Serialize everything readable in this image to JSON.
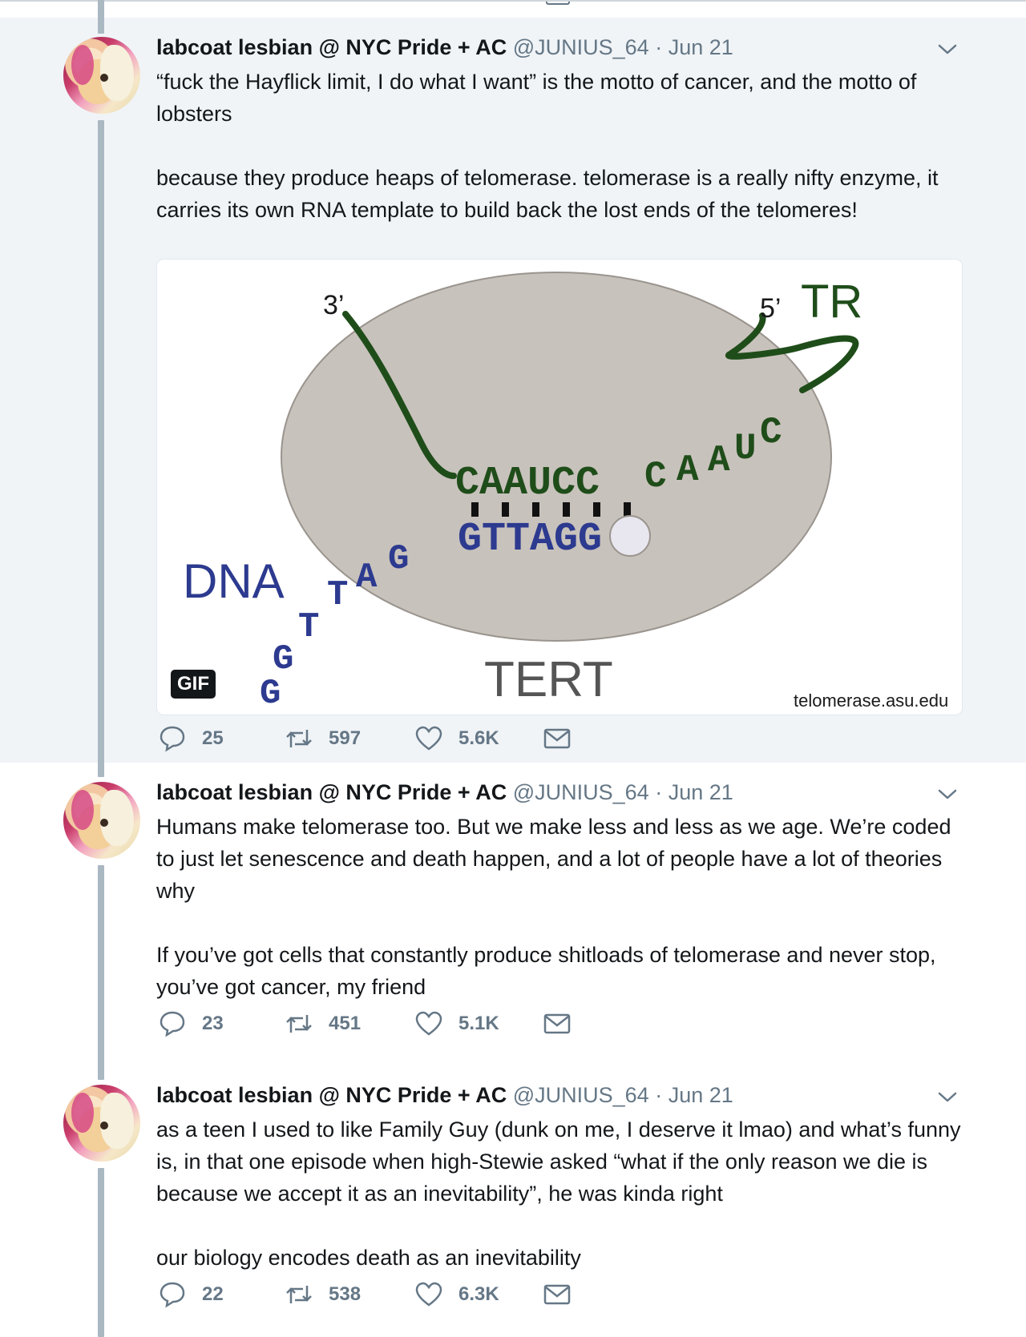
{
  "tweets": [
    {
      "name": "labcoat lesbian @ NYC Pride + AC",
      "handle": "@JUNIUS_64",
      "dot": "·",
      "date": "Jun 21",
      "paragraphs": [
        "“fuck the Hayflick limit, I do what I want” is the motto of cancer, and the motto of lobsters",
        "because they produce heaps of telomerase. telomerase is a really nifty enzyme, it carries its own RNA template to build back the lost ends of the telomeres!"
      ],
      "media": {
        "gif_label": "GIF",
        "credit": "telomerase.asu.edu",
        "labels": {
          "three_prime": "3’",
          "five_prime": "5’",
          "tr": "TR",
          "dna": "DNA",
          "tert": "TERT",
          "rna_template": "CAAUCC",
          "rna_tail": [
            "C",
            "A",
            "A",
            "U",
            "C"
          ],
          "dna_paired": "GTTAGG",
          "dna_tail": [
            "G",
            "G",
            "T",
            "T",
            "A",
            "G"
          ]
        }
      },
      "replies": "25",
      "retweets": "597",
      "likes": "5.6K"
    },
    {
      "name": "labcoat lesbian @ NYC Pride + AC",
      "handle": "@JUNIUS_64",
      "dot": "·",
      "date": "Jun 21",
      "paragraphs": [
        "Humans make telomerase too. But we make less and less as we age. We’re coded to just let senescence and death happen, and a lot of people have a lot of theories why",
        "If you’ve got cells that constantly produce shitloads of telomerase and never stop, you’ve got cancer, my friend"
      ],
      "replies": "23",
      "retweets": "451",
      "likes": "5.1K"
    },
    {
      "name": "labcoat lesbian @ NYC Pride + AC",
      "handle": "@JUNIUS_64",
      "dot": "·",
      "date": "Jun 21",
      "paragraphs": [
        "as a teen I used to like Family Guy (dunk on me, I deserve it lmao) and what’s funny is, in that one episode when high-Stewie asked “what if the only reason we die is because we accept it as an inevitability”, he was kinda right",
        "our biology encodes death as an inevitability"
      ],
      "replies": "22",
      "retweets": "538",
      "likes": "6.3K"
    }
  ]
}
